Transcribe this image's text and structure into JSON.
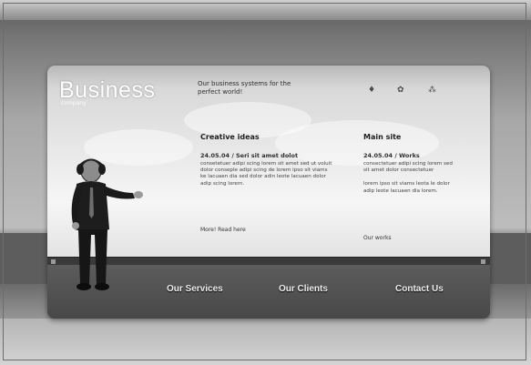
{
  "brand": {
    "name": "Business",
    "sub": "company"
  },
  "tagline": "Our business systems for the perfect world!",
  "top_icons": [
    "♦",
    "✿",
    "⁂"
  ],
  "columns": [
    {
      "heading": "Creative ideas",
      "date": "24.05.04 / Seri sit amet dolot",
      "text": "consetetuer adipi scing lorem sit amet sed ut voluit dolor conseple adipi scing de lorem ipso sit viams ke lacuaen dia sed dolor adin leote lacuaen dolor adip scing lorem.",
      "link": "More! Read here"
    },
    {
      "heading": "Main site",
      "date": "24.05.04 / Works",
      "text": "consectetuer adipi scing lorem sed sit amet dolor consectetuer",
      "text2": "lorem ipso sit viams leota le dolor adip leote lacuaen dia lorem.",
      "link": "Our works"
    }
  ],
  "nav": {
    "items": [
      "Our Services",
      "Our Clients",
      "Contact Us"
    ]
  },
  "colors": {
    "panel_bottom": "#4a4a4a",
    "nav_text": "#eeeeee",
    "logo": "#ffffff"
  }
}
